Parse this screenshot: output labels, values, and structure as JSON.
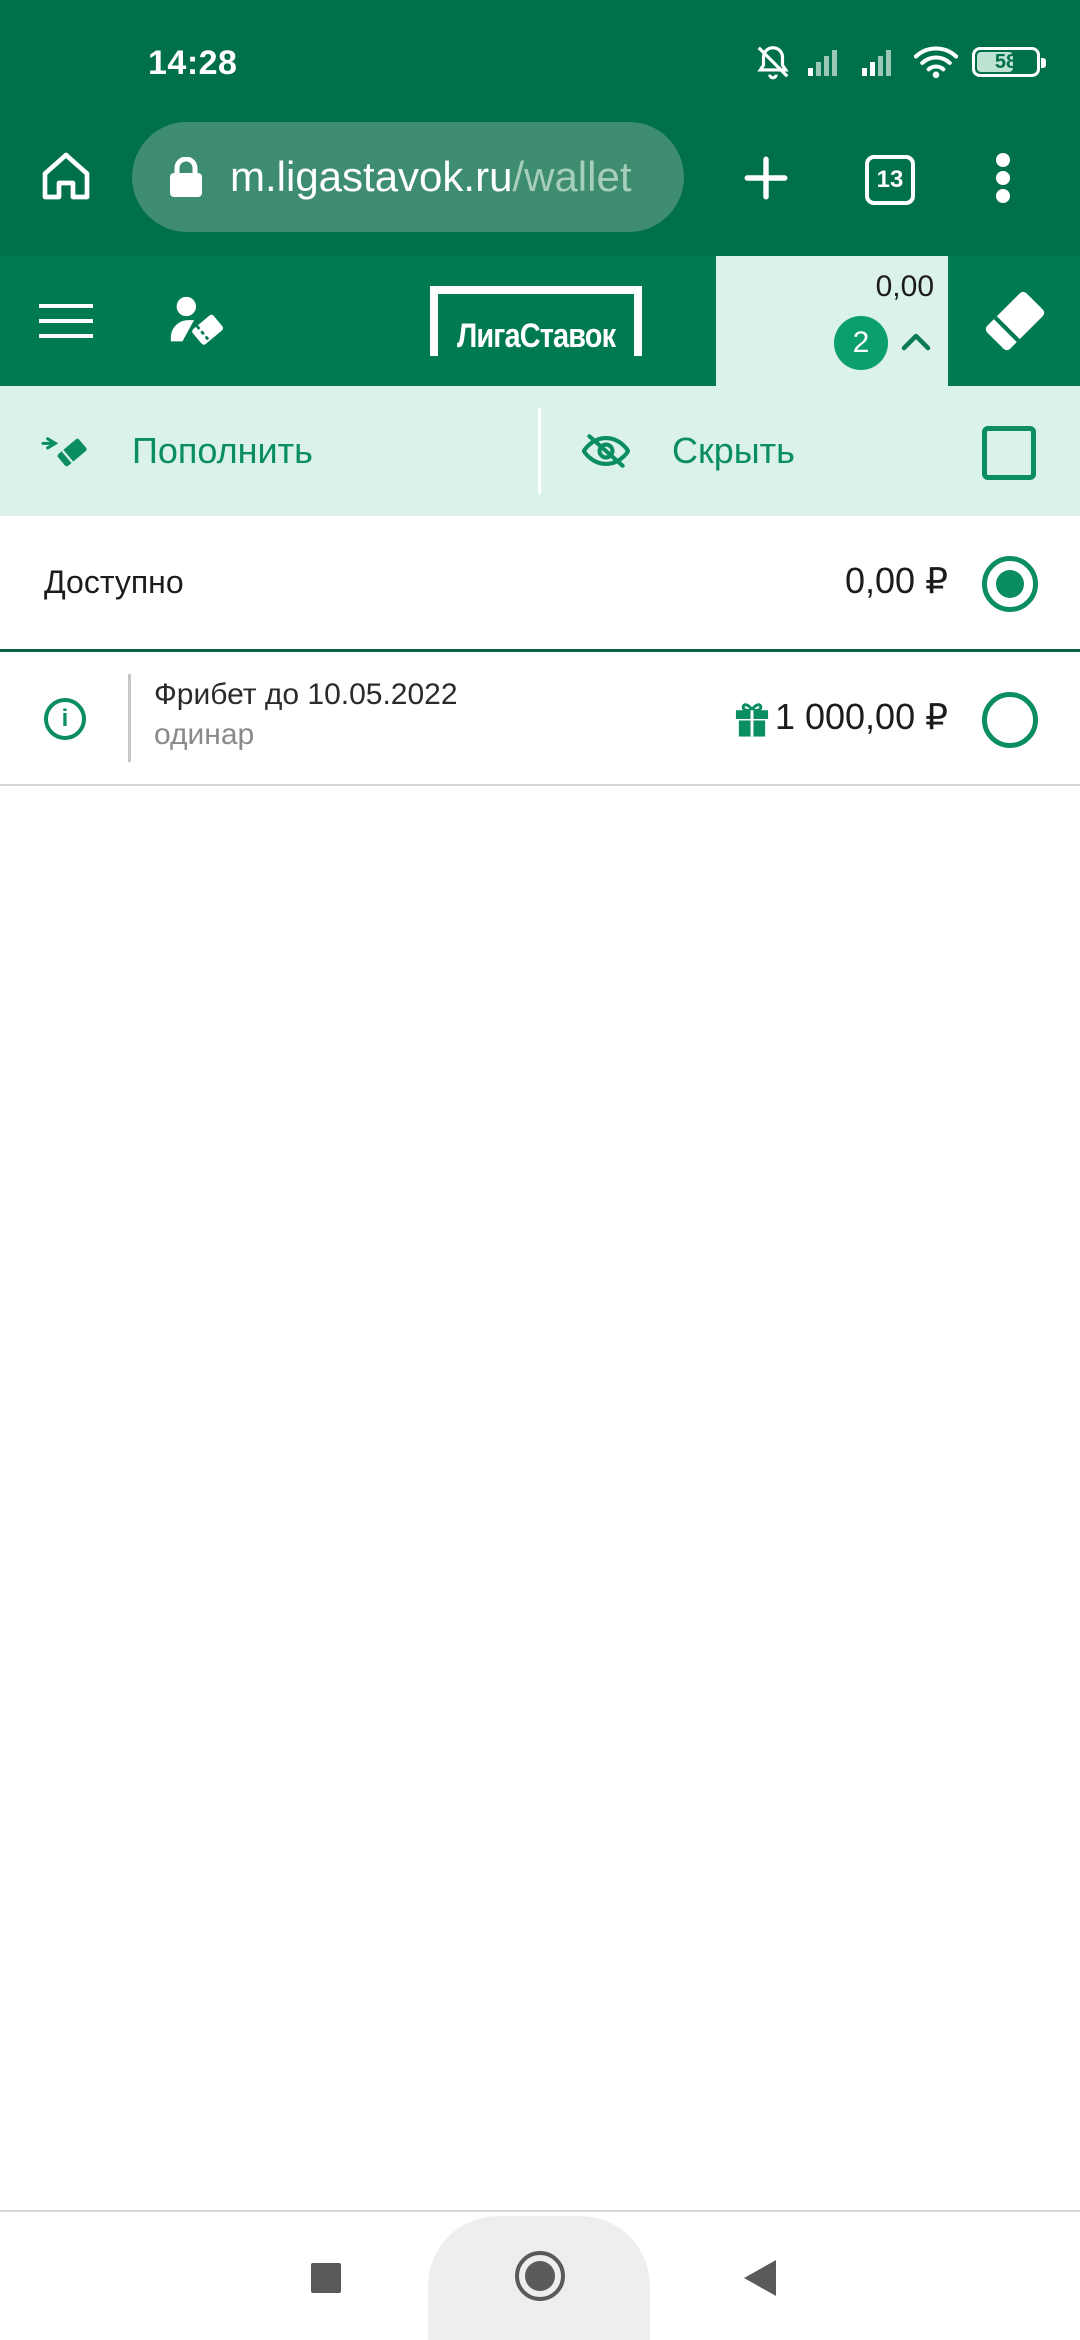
{
  "status_bar": {
    "time": "14:28",
    "battery_level": "58",
    "icons": [
      "bell-off-icon",
      "signal-icon",
      "signal-icon",
      "wifi-icon",
      "battery-icon"
    ]
  },
  "browser": {
    "url_host": "m.ligastavok.ru",
    "url_path": "/wallet",
    "tab_count": "13",
    "icons": [
      "home-icon",
      "lock-icon",
      "plus-icon",
      "tabs-icon",
      "more-vert-icon"
    ]
  },
  "header": {
    "logo_text": "ЛигаСтавок",
    "balance": "0,00",
    "badge_count": "2",
    "icons": [
      "menu-icon",
      "profile-coupon-icon",
      "chevron-up-icon",
      "coupon-icon"
    ]
  },
  "actions": {
    "deposit_label": "Пополнить",
    "hide_label": "Скрыть",
    "hide_checked": false
  },
  "wallets": {
    "available": {
      "label": "Доступно",
      "amount": "0,00 ₽",
      "selected": true
    },
    "freebet": {
      "title": "Фрибет до 10.05.2022",
      "subtitle": "одинар",
      "amount": "1 000,00 ₽",
      "selected": false
    }
  },
  "colors": {
    "brand_dark": "#00704c",
    "brand": "#007a52",
    "accent": "#0a8e5f",
    "tint": "#daf2ea"
  }
}
